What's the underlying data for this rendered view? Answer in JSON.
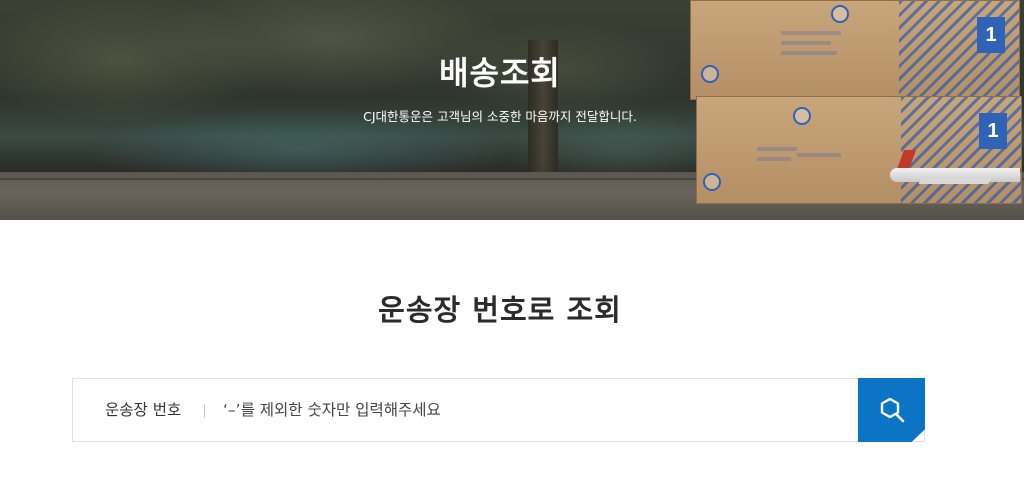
{
  "hero": {
    "title": "배송조회",
    "subtitle": "CJ대한통운은 고객님의 소중한 마음까지 전달합니다.",
    "box_number": "1"
  },
  "tracking": {
    "section_title": "운송장 번호로 조회",
    "field_label": "운송장 번호",
    "input_placeholder": "‘–’를 제외한 숫자만 입력해주세요",
    "input_value": "",
    "search_button_icon": "search-icon"
  },
  "colors": {
    "accent": "#0b74c4",
    "title_text": "#2b2b2b",
    "border": "#e1e1e1"
  }
}
